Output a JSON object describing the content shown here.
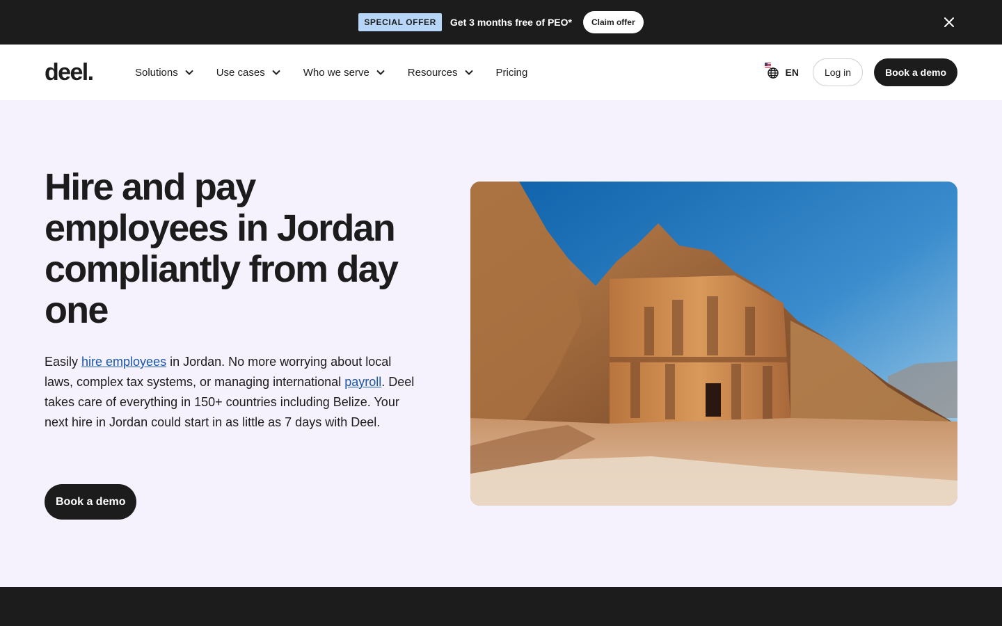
{
  "promo": {
    "badge": "SPECIAL OFFER",
    "text": "Get 3 months free of PEO*",
    "cta": "Claim offer"
  },
  "nav": {
    "logo": "deel.",
    "items": [
      {
        "label": "Solutions",
        "dropdown": true
      },
      {
        "label": "Use cases",
        "dropdown": true
      },
      {
        "label": "Who we serve",
        "dropdown": true
      },
      {
        "label": "Resources",
        "dropdown": true
      },
      {
        "label": "Pricing",
        "dropdown": false
      }
    ],
    "language": "EN",
    "login": "Log in",
    "book_demo": "Book a demo"
  },
  "hero": {
    "title": "Hire and pay employees in Jordan compliantly from day one",
    "desc_part1": "Easily ",
    "desc_link1": "hire employees",
    "desc_part2": " in Jordan. No more worrying about local laws, complex tax systems, or managing international ",
    "desc_link2": "payroll",
    "desc_part3": ". Deel takes care of everything in 150+ countries including Belize. Your next hire in Jordan could start in as little as 7 days with Deel.",
    "cta": "Book a demo"
  },
  "colors": {
    "dark": "#1c1c1c",
    "badge": "#b7d6f7",
    "hero_bg": "#f5f1fd",
    "link": "#1a56a6"
  }
}
